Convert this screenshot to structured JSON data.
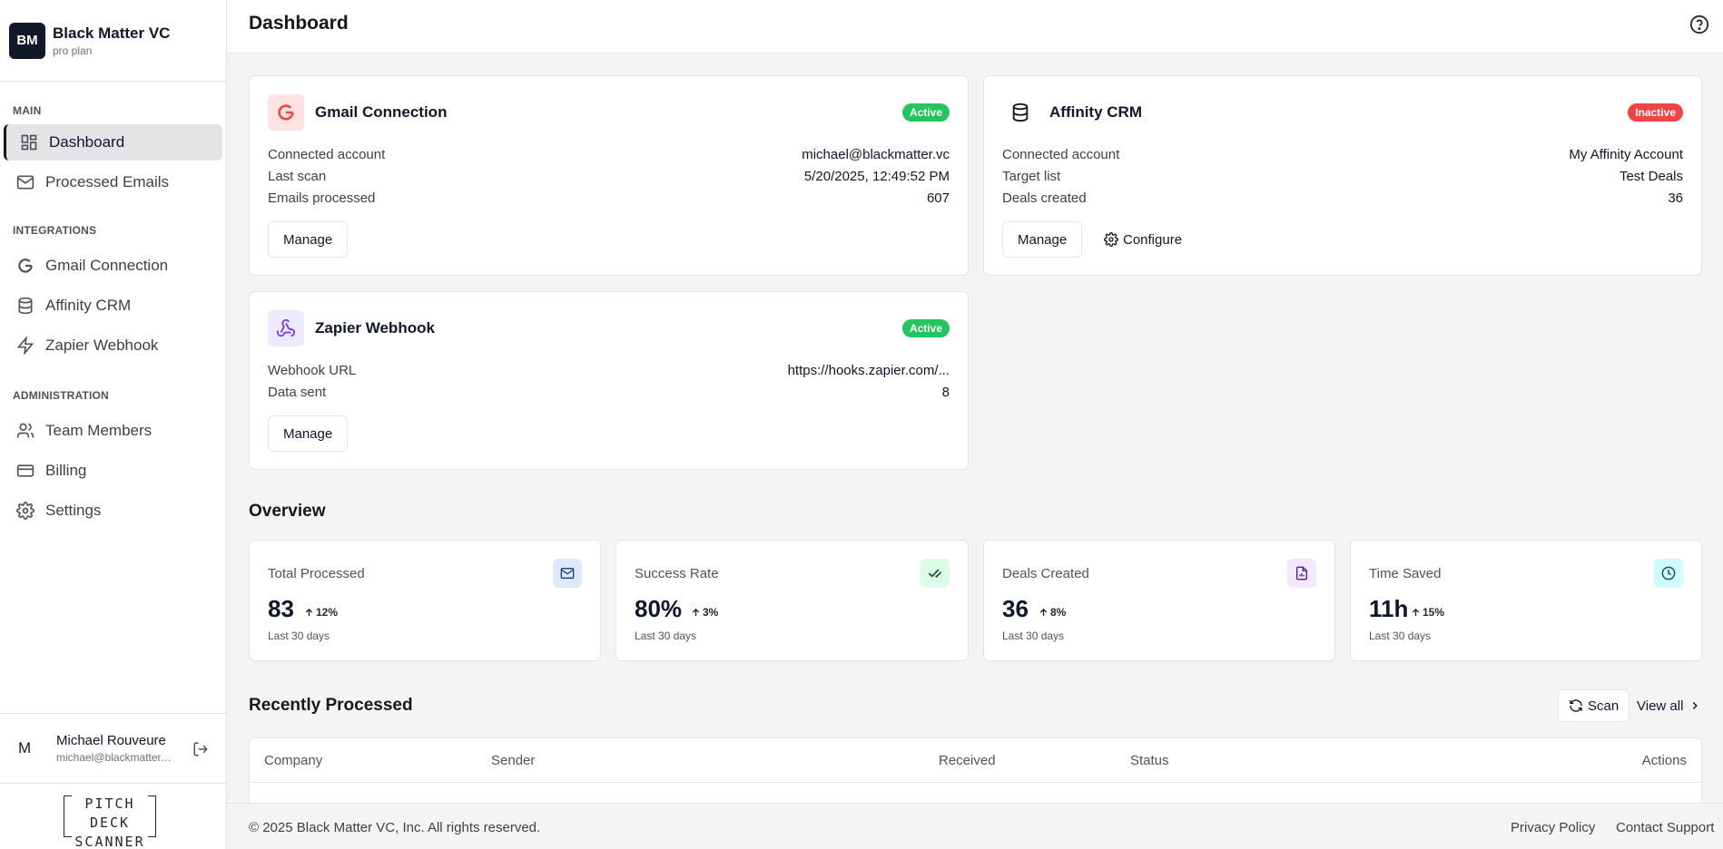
{
  "brand": {
    "initials": "BM",
    "name": "Black Matter VC",
    "plan": "pro plan"
  },
  "nav": {
    "main_label": "MAIN",
    "dashboard": "Dashboard",
    "processed_emails": "Processed Emails",
    "integrations_label": "INTEGRATIONS",
    "gmail": "Gmail Connection",
    "affinity": "Affinity CRM",
    "zapier": "Zapier Webhook",
    "admin_label": "ADMINISTRATION",
    "team": "Team Members",
    "billing": "Billing",
    "settings": "Settings"
  },
  "user": {
    "initial": "M",
    "name": "Michael Rouveure",
    "email": "michael@blackmatter.vc"
  },
  "product_logo": {
    "line1": "PITCH DECK",
    "line2": "SCANNER"
  },
  "header": {
    "title": "Dashboard"
  },
  "gmail_card": {
    "title": "Gmail Connection",
    "status": "Active",
    "rows": [
      {
        "label": "Connected account",
        "value": "michael@blackmatter.vc"
      },
      {
        "label": "Last scan",
        "value": "5/20/2025, 12:49:52 PM"
      },
      {
        "label": "Emails processed",
        "value": "607"
      }
    ],
    "manage": "Manage"
  },
  "affinity_card": {
    "title": "Affinity CRM",
    "status": "Inactive",
    "rows": [
      {
        "label": "Connected account",
        "value": "My Affinity Account"
      },
      {
        "label": "Target list",
        "value": "Test Deals"
      },
      {
        "label": "Deals created",
        "value": "36"
      }
    ],
    "manage": "Manage",
    "configure": "Configure"
  },
  "zapier_card": {
    "title": "Zapier Webhook",
    "status": "Active",
    "rows": [
      {
        "label": "Webhook URL",
        "value": "https://hooks.zapier.com/..."
      },
      {
        "label": "Data sent",
        "value": "8"
      }
    ],
    "manage": "Manage"
  },
  "overview": {
    "title": "Overview",
    "stats": [
      {
        "label": "Total Processed",
        "value": "83",
        "delta": "12%",
        "period": "Last 30 days"
      },
      {
        "label": "Success Rate",
        "value": "80%",
        "delta": "3%",
        "period": "Last 30 days"
      },
      {
        "label": "Deals Created",
        "value": "36",
        "delta": "8%",
        "period": "Last 30 days"
      },
      {
        "label": "Time Saved",
        "value": "11h",
        "delta": "15%",
        "period": "Last 30 days"
      }
    ]
  },
  "recent": {
    "title": "Recently Processed",
    "scan": "Scan",
    "view_all": "View all",
    "columns": [
      "Company",
      "Sender",
      "Received",
      "Status",
      "Actions"
    ]
  },
  "footer": {
    "copyright": "© 2025 Black Matter VC, Inc. All rights reserved.",
    "privacy": "Privacy Policy",
    "contact": "Contact Support"
  },
  "colors": {
    "active": "#22c55e",
    "inactive": "#ef4444",
    "gmail_red": "#ef4444",
    "zapier_purple": "#7c3aed"
  }
}
